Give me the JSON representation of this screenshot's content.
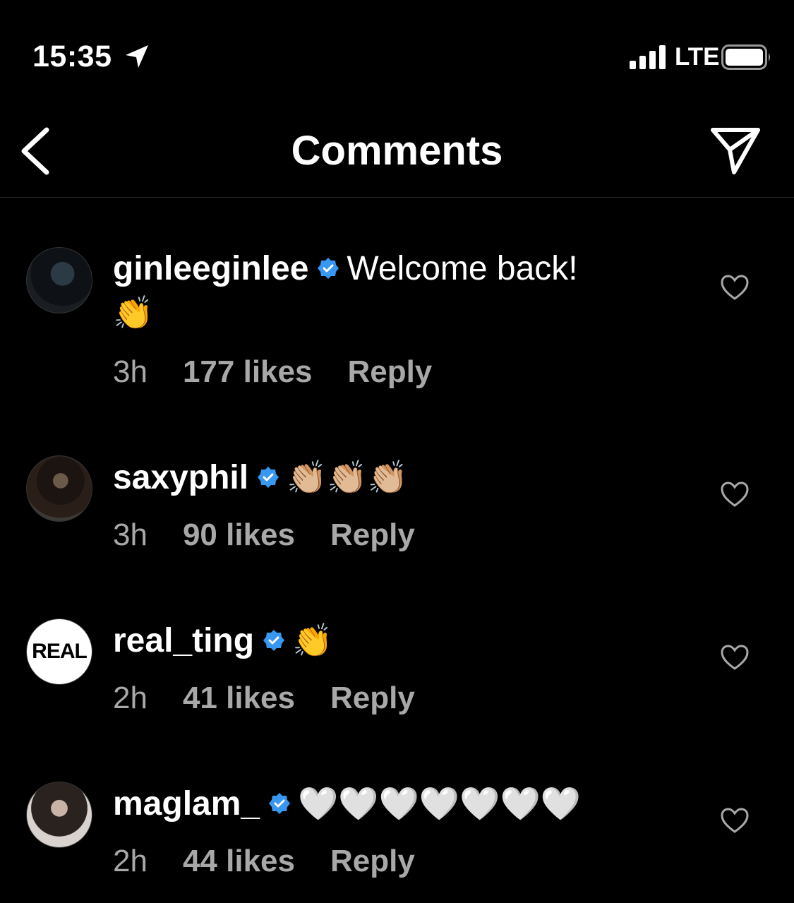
{
  "status_bar": {
    "time": "15:35",
    "network": "LTE"
  },
  "header": {
    "title": "Comments"
  },
  "comments": [
    {
      "username": "ginleeginlee",
      "verified": true,
      "text": "Welcome back!",
      "emoji": "👏",
      "age": "3h",
      "likes": "177 likes",
      "reply": "Reply"
    },
    {
      "username": "saxyphil",
      "verified": true,
      "text": "",
      "emoji": "👏🏼👏🏼👏🏼",
      "age": "3h",
      "likes": "90 likes",
      "reply": "Reply"
    },
    {
      "username": "real_ting",
      "verified": true,
      "avatar_text": "REAL",
      "text": "",
      "emoji": "👏",
      "age": "2h",
      "likes": "41 likes",
      "reply": "Reply"
    },
    {
      "username": "maglam_",
      "verified": true,
      "text": "",
      "emoji": "🤍🤍🤍🤍🤍🤍🤍",
      "age": "2h",
      "likes": "44 likes",
      "reply": "Reply"
    }
  ],
  "colors": {
    "background": "#000000",
    "secondary_text": "#a8a8a8",
    "verified_blue": "#3897f0"
  },
  "icons": [
    "location-arrow-icon",
    "signal-icon",
    "battery-icon",
    "back-chevron-icon",
    "send-icon",
    "verified-badge-icon",
    "heart-icon"
  ]
}
